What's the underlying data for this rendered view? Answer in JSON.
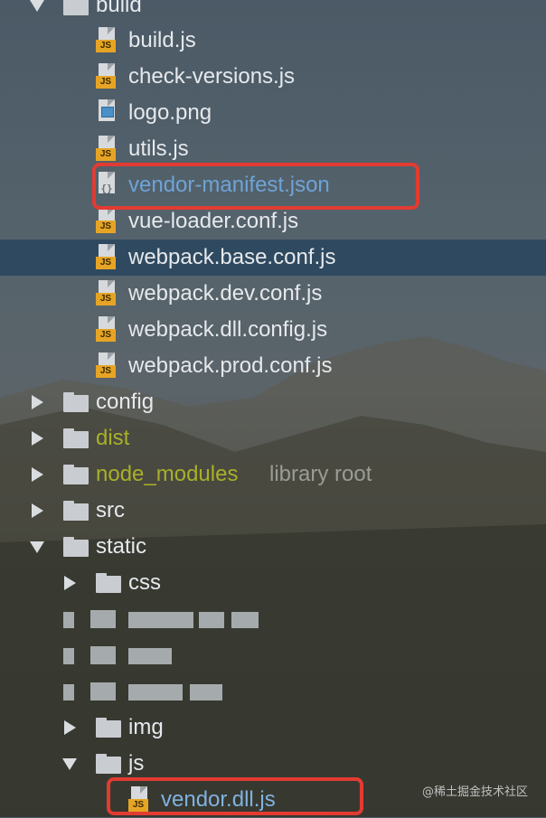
{
  "tree": {
    "build": {
      "label": "build"
    },
    "build_files": [
      {
        "name": "build.js",
        "type": "js"
      },
      {
        "name": "check-versions.js",
        "type": "js"
      },
      {
        "name": "logo.png",
        "type": "image"
      },
      {
        "name": "utils.js",
        "type": "js"
      },
      {
        "name": "vendor-manifest.json",
        "type": "json"
      },
      {
        "name": "vue-loader.conf.js",
        "type": "js"
      },
      {
        "name": "webpack.base.conf.js",
        "type": "js",
        "selected": true
      },
      {
        "name": "webpack.dev.conf.js",
        "type": "js"
      },
      {
        "name": "webpack.dll.config.js",
        "type": "js"
      },
      {
        "name": "webpack.prod.conf.js",
        "type": "js"
      }
    ],
    "top_folders": {
      "config": "config",
      "dist": "dist",
      "node_modules": "node_modules",
      "node_modules_note": "library root",
      "src": "src",
      "static": "static"
    },
    "static_children": {
      "css": "css",
      "img": "img",
      "js": "js"
    },
    "js_files": [
      {
        "name": "vendor.dll.js",
        "type": "js"
      }
    ],
    "badge_js": "JS"
  },
  "watermark": "@稀土掘金技术社区",
  "colors": {
    "selected_row": "#2f4a60",
    "excluded_text": "#a8b02a",
    "json_text": "#6fa3d6",
    "highlight_box": "#e23b32"
  }
}
